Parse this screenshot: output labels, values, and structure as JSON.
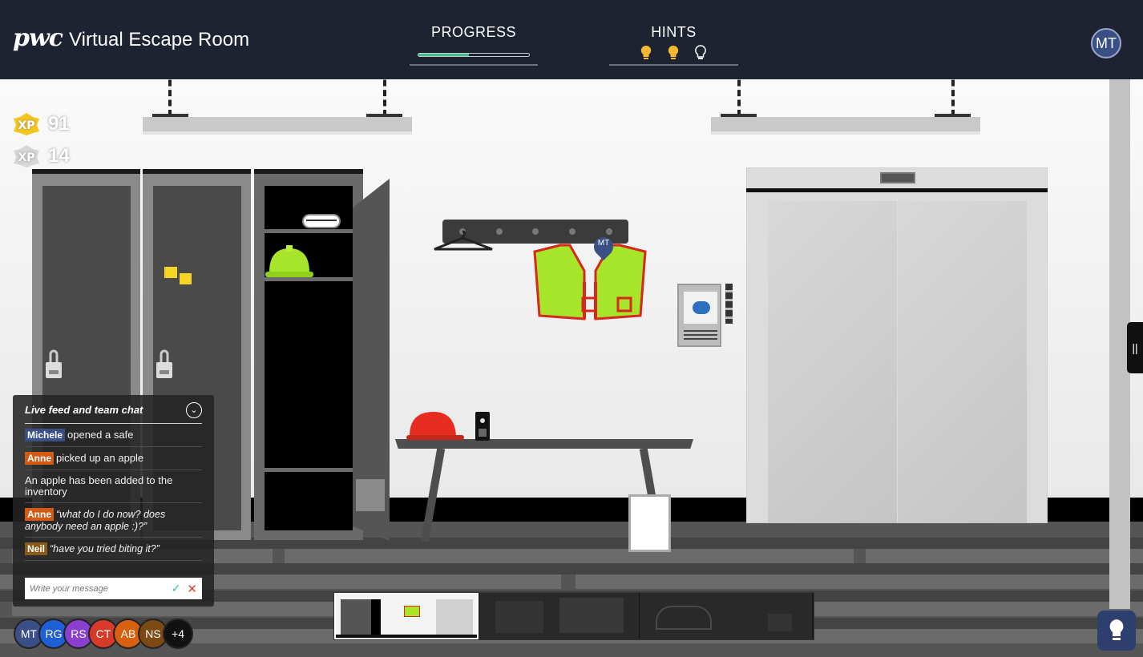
{
  "header": {
    "logo_mark": "pwc",
    "title": "Virtual Escape Room",
    "progress_label": "PROGRESS",
    "progress_value": 0.46,
    "hints_label": "HINTS",
    "hints": [
      {
        "state": "used",
        "color": "#f5b82e"
      },
      {
        "state": "used",
        "color": "#f5b82e"
      },
      {
        "state": "available",
        "color": "#ffffff"
      }
    ],
    "user_initials": "MT"
  },
  "xp": {
    "gold": "91",
    "silver": "14"
  },
  "scene": {
    "vest_marker": "MT"
  },
  "chat": {
    "title": "Live feed and team chat",
    "feed": [
      {
        "name": "Michele",
        "name_color": "#3a4f86",
        "text": "opened a safe",
        "quote": false
      },
      {
        "name": "Anne",
        "name_color": "#d25a12",
        "text": "picked up an apple",
        "quote": false
      },
      {
        "name": "",
        "name_color": "",
        "text": "An apple has been added to the inventory",
        "quote": false
      },
      {
        "name": "Anne",
        "name_color": "#d25a12",
        "text": "“what do I do now? does anybody need an apple :)?”",
        "quote": true
      },
      {
        "name": "Neil",
        "name_color": "#8a5a1a",
        "text": "“have you tried biting it?”",
        "quote": true
      }
    ],
    "input_placeholder": "Write your message"
  },
  "team": [
    {
      "initials": "MT",
      "color": "#3a4f86"
    },
    {
      "initials": "RG",
      "color": "#1f5fd6"
    },
    {
      "initials": "RS",
      "color": "#8a3fd1"
    },
    {
      "initials": "CT",
      "color": "#d83a2a"
    },
    {
      "initials": "AB",
      "color": "#d9600f"
    },
    {
      "initials": "NS",
      "color": "#7a4a12"
    },
    {
      "initials": "+4",
      "color": "#111111"
    }
  ],
  "colors": {
    "header_bg": "#1d2330",
    "accent_progress": "#3fbf8b",
    "hint_button": "#2e3e6e"
  }
}
